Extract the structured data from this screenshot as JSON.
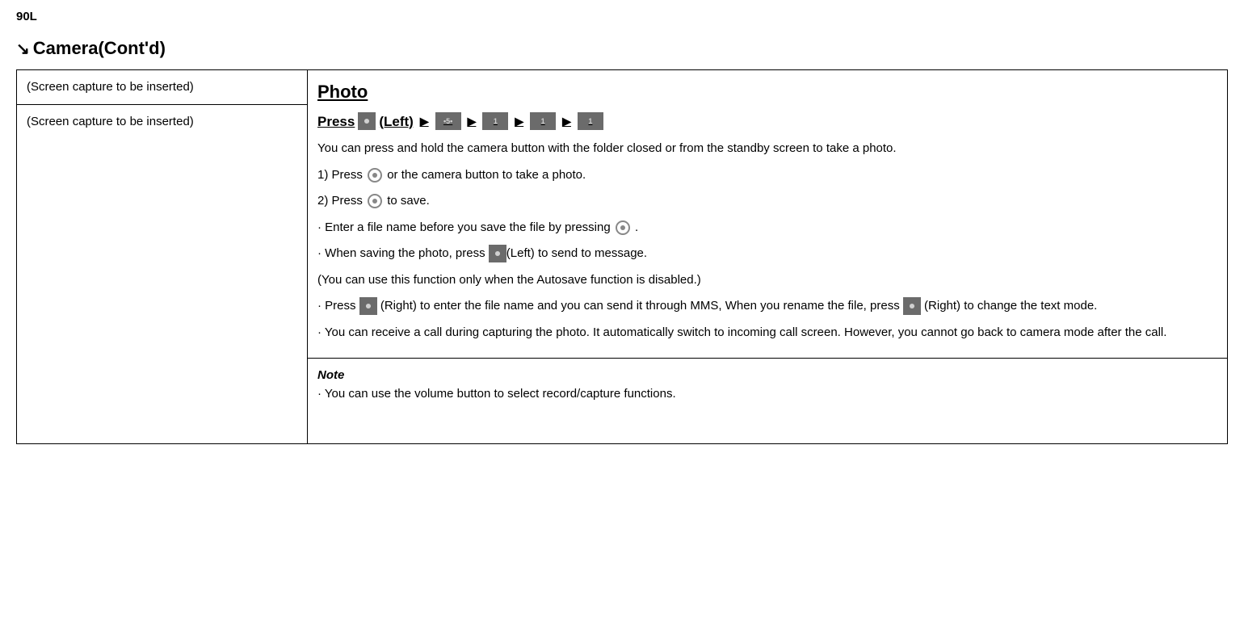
{
  "page_label": "90L",
  "section_title": "Camera(Cont'd)",
  "left_placeholder": "(Screen capture to be inserted)",
  "photo_heading": "Photo",
  "press_line": {
    "press": "Press",
    "left_sfx": "(Left)"
  },
  "intro": "You can press and hold the camera button with the folder closed or from the standby screen to take a photo.",
  "step1_a": "1) Press",
  "step1_b": "or the camera button to take a photo.",
  "step2_a": "2) Press",
  "step2_b": "to save.",
  "bul1_a": "· Enter a file name before you save the file by pressing",
  "bul1_b": ".",
  "bul2_a": "· When saving the photo, press",
  "bul2_b": "(Left) to send to message.",
  "bul2_note": "(You can use this function only when the Autosave function is disabled.)",
  "bul3_a": "· Press",
  "bul3_b": "(Right) to enter the file name and you can send it through MMS, When you rename the file, press",
  "bul3_c": "(Right) to change the text mode.",
  "bul4": "· You can receive a call during capturing the photo. It automatically switch to incoming call screen. However, you cannot go back to camera mode after the call.",
  "note_label": "Note",
  "note_body": "· You can use the volume button to select record/capture functions."
}
